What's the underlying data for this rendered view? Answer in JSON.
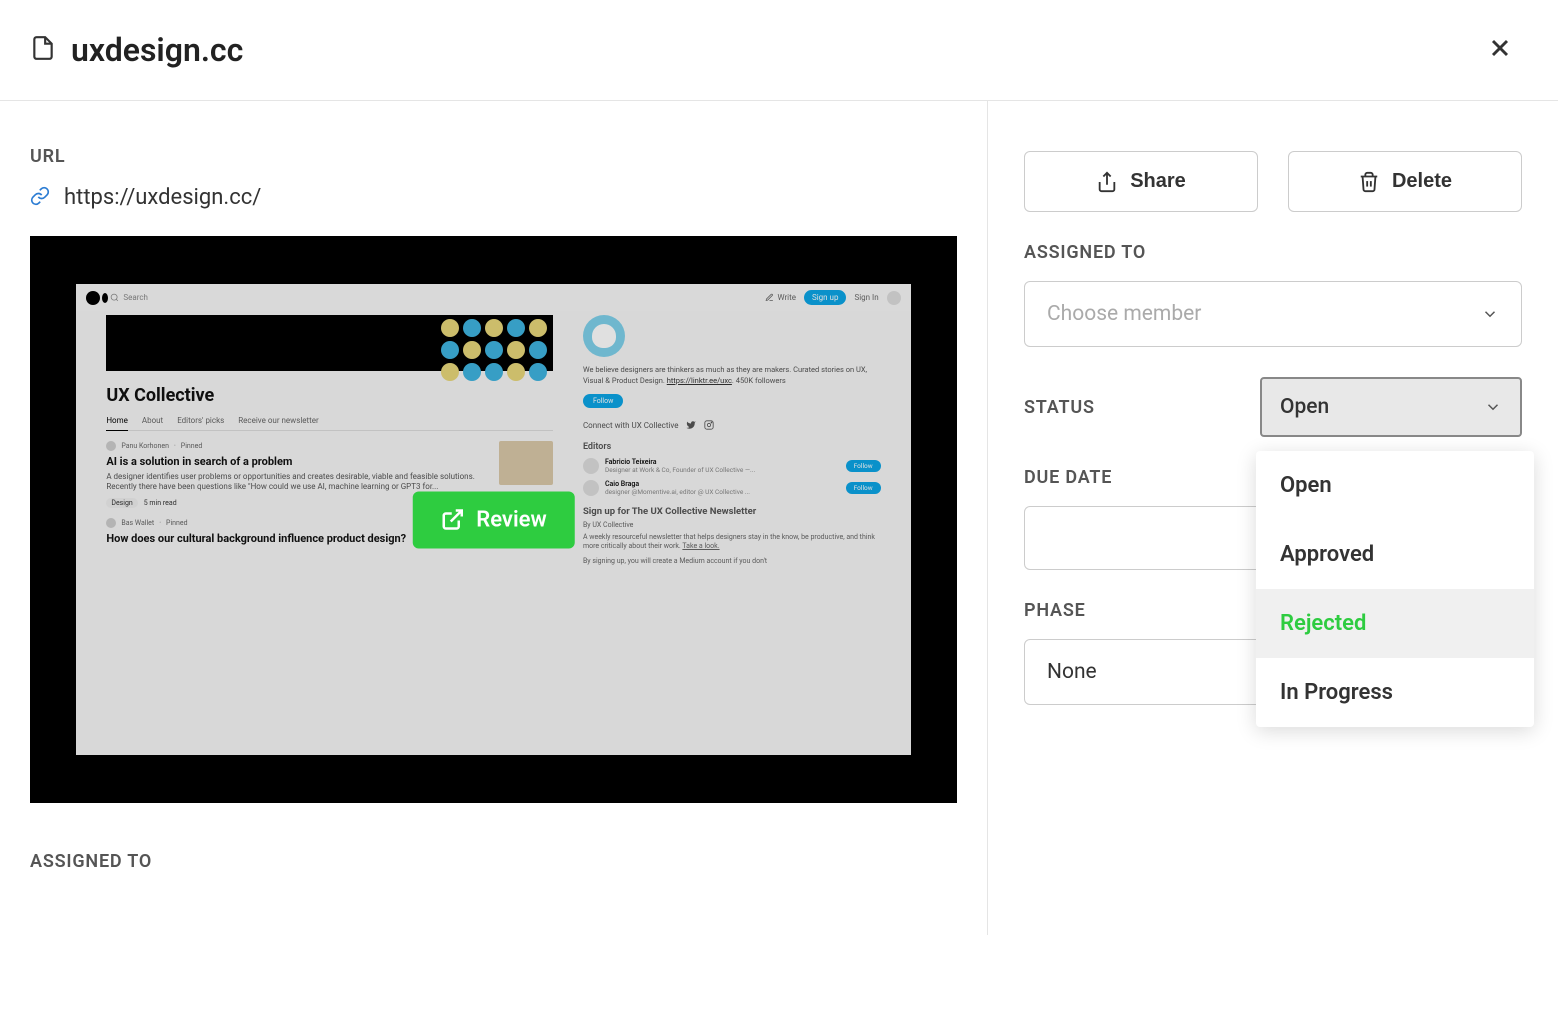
{
  "header": {
    "title": "uxdesign.cc"
  },
  "left": {
    "url_label": "URL",
    "url_value": "https://uxdesign.cc/",
    "review_label": "Review",
    "assigned_to_label": "ASSIGNED TO",
    "preview": {
      "search_placeholder": "Search",
      "write": "Write",
      "signup": "Sign up",
      "signin": "Sign In",
      "brand": "UX Collective",
      "tabs": [
        "Home",
        "About",
        "Editors' picks",
        "Receive our newsletter"
      ],
      "mission": "We believe designers are thinkers as much as they are makers. Curated stories on UX, Visual & Product Design.",
      "mission_link": "https://linktr.ee/uxc",
      "followers": "450K followers",
      "follow": "Follow",
      "connect": "Connect with UX Collective",
      "article1_author": "Panu Korhonen",
      "article1_pinned": "Pinned",
      "article1_title": "AI is a solution in search of a problem",
      "article1_sub": "A designer identifies user problems or opportunities and creates desirable, viable and feasible solutions. Recently there have been questions like \"How could we use AI, machine learning or GPT3 for...",
      "article1_tag": "Design",
      "article1_read": "5 min read",
      "article2_author": "Bas Wallet",
      "article2_pinned": "Pinned",
      "article2_title": "How does our cultural background influence product design?",
      "editors_label": "Editors",
      "editor1_name": "Fabricio Teixeira",
      "editor1_sub": "Designer at Work & Co, Founder of UX Collective —...",
      "editor2_name": "Caio Braga",
      "editor2_sub": "designer @Momentive.ai, editor @ UX Collective ...",
      "newsletter_title": "Sign up for The UX Collective Newsletter",
      "newsletter_by": "By UX Collective",
      "newsletter_desc": "A weekly resourceful newsletter that helps designers stay in the know, be productive, and think more critically about their work.",
      "newsletter_link": "Take a look.",
      "newsletter_foot": "By signing up, you will create a Medium account if you don't"
    }
  },
  "right": {
    "share_label": "Share",
    "delete_label": "Delete",
    "assigned_to_label": "ASSIGNED TO",
    "assigned_placeholder": "Choose member",
    "status_label": "STATUS",
    "status_value": "Open",
    "status_options": [
      "Open",
      "Approved",
      "Rejected",
      "In Progress"
    ],
    "status_highlighted_index": 2,
    "due_date_label": "DUE DATE",
    "phase_label": "PHASE",
    "phase_value": "None"
  }
}
